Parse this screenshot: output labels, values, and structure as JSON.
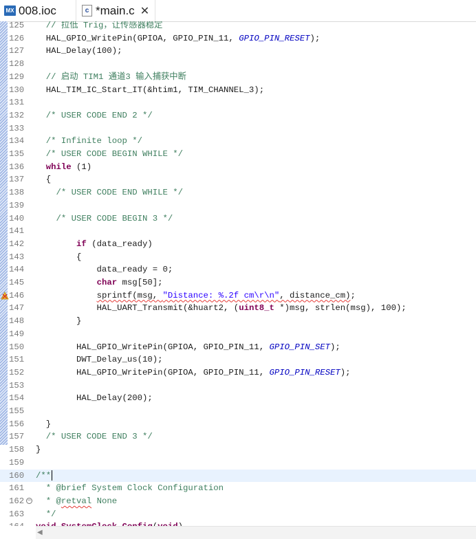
{
  "tabs": [
    {
      "icon": "MX",
      "label": "008.ioc"
    },
    {
      "icon": "c",
      "label": "*main.c",
      "close": "✕"
    }
  ],
  "lines": [
    {
      "n": "125",
      "spans": [
        {
          "t": "  // 拉低 Trig，让传感器稳定",
          "c": "cm"
        }
      ]
    },
    {
      "n": "126",
      "spans": [
        {
          "t": "  HAL_GPIO_WritePin(GPIOA, GPIO_PIN_11, "
        },
        {
          "t": "GPIO_PIN_RESET",
          "c": "macro"
        },
        {
          "t": ");"
        }
      ]
    },
    {
      "n": "127",
      "spans": [
        {
          "t": "  HAL_Delay(100);"
        }
      ]
    },
    {
      "n": "128",
      "spans": []
    },
    {
      "n": "129",
      "spans": [
        {
          "t": "  // 启动 TIM1 通道3 输入捕获中断",
          "c": "cm"
        }
      ]
    },
    {
      "n": "130",
      "spans": [
        {
          "t": "  HAL_TIM_IC_Start_IT(&htim1, TIM_CHANNEL_3);"
        }
      ]
    },
    {
      "n": "131",
      "spans": []
    },
    {
      "n": "132",
      "spans": [
        {
          "t": "  /* USER CODE END 2 */",
          "c": "cm"
        }
      ]
    },
    {
      "n": "133",
      "spans": []
    },
    {
      "n": "134",
      "spans": [
        {
          "t": "  /* Infinite loop */",
          "c": "cm"
        }
      ]
    },
    {
      "n": "135",
      "spans": [
        {
          "t": "  /* USER CODE BEGIN WHILE */",
          "c": "cm"
        }
      ]
    },
    {
      "n": "136",
      "spans": [
        {
          "t": "  "
        },
        {
          "t": "while",
          "c": "kw"
        },
        {
          "t": " (1)"
        }
      ]
    },
    {
      "n": "137",
      "spans": [
        {
          "t": "  {"
        }
      ]
    },
    {
      "n": "138",
      "spans": [
        {
          "t": "    /* USER CODE END WHILE */",
          "c": "cm"
        }
      ]
    },
    {
      "n": "139",
      "spans": []
    },
    {
      "n": "140",
      "spans": [
        {
          "t": "    /* USER CODE BEGIN 3 */",
          "c": "cm"
        }
      ]
    },
    {
      "n": "141",
      "spans": []
    },
    {
      "n": "142",
      "spans": [
        {
          "t": "        "
        },
        {
          "t": "if",
          "c": "kw"
        },
        {
          "t": " (data_ready)"
        }
      ]
    },
    {
      "n": "143",
      "spans": [
        {
          "t": "        {"
        }
      ]
    },
    {
      "n": "144",
      "spans": [
        {
          "t": "            data_ready = 0;"
        }
      ]
    },
    {
      "n": "145",
      "spans": [
        {
          "t": "            "
        },
        {
          "t": "char",
          "c": "kw"
        },
        {
          "t": " msg[50];"
        }
      ]
    },
    {
      "n": "146",
      "warn": true,
      "spans": [
        {
          "t": "            "
        },
        {
          "t": "sprintf(msg, ",
          "c": "squig"
        },
        {
          "t": "\"Distance: %.2f cm\\r\\n\"",
          "c": "str squig"
        },
        {
          "t": ", distance_cm)",
          "c": "squig"
        },
        {
          "t": ";"
        }
      ]
    },
    {
      "n": "147",
      "spans": [
        {
          "t": "            HAL_UART_Transmit(&huart2, ("
        },
        {
          "t": "uint8_t",
          "c": "kw"
        },
        {
          "t": " *)msg, strlen(msg), 100);"
        }
      ]
    },
    {
      "n": "148",
      "spans": [
        {
          "t": "        }"
        }
      ]
    },
    {
      "n": "149",
      "spans": []
    },
    {
      "n": "150",
      "spans": [
        {
          "t": "        HAL_GPIO_WritePin(GPIOA, GPIO_PIN_11, "
        },
        {
          "t": "GPIO_PIN_SET",
          "c": "macro"
        },
        {
          "t": ");"
        }
      ]
    },
    {
      "n": "151",
      "spans": [
        {
          "t": "        DWT_Delay_us(10);"
        }
      ]
    },
    {
      "n": "152",
      "spans": [
        {
          "t": "        HAL_GPIO_WritePin(GPIOA, GPIO_PIN_11, "
        },
        {
          "t": "GPIO_PIN_RESET",
          "c": "macro"
        },
        {
          "t": ");"
        }
      ]
    },
    {
      "n": "153",
      "spans": []
    },
    {
      "n": "154",
      "spans": [
        {
          "t": "        HAL_Delay(200);"
        }
      ]
    },
    {
      "n": "155",
      "spans": []
    },
    {
      "n": "156",
      "spans": [
        {
          "t": "  }"
        }
      ]
    },
    {
      "n": "157",
      "spans": [
        {
          "t": "  /* USER CODE END 3 */",
          "c": "cm"
        }
      ]
    },
    {
      "n": "158",
      "spans": [
        {
          "t": "}"
        }
      ]
    },
    {
      "n": "159",
      "spans": []
    },
    {
      "n": "160",
      "current": true,
      "caret": true,
      "spans": [
        {
          "t": "/**",
          "c": "cm"
        }
      ]
    },
    {
      "n": "161",
      "spans": [
        {
          "t": "  * @brief System Clock Configuration",
          "c": "cm"
        }
      ]
    },
    {
      "n": "162",
      "fold": true,
      "spans": [
        {
          "t": "  * @",
          "c": "cm"
        },
        {
          "t": "retval",
          "c": "cm squig"
        },
        {
          "t": " None",
          "c": "cm"
        }
      ]
    },
    {
      "n": "163",
      "spans": [
        {
          "t": "  */",
          "c": "cm"
        }
      ]
    },
    {
      "n": "164",
      "spans": [
        {
          "t": "void",
          "c": "kw"
        },
        {
          "t": " "
        },
        {
          "t": "SystemClock_Config",
          "c": "kw"
        },
        {
          "t": "("
        },
        {
          "t": "void",
          "c": "kw"
        },
        {
          "t": ")"
        }
      ]
    }
  ],
  "scrollbar": {
    "left_arrow": "◀"
  }
}
